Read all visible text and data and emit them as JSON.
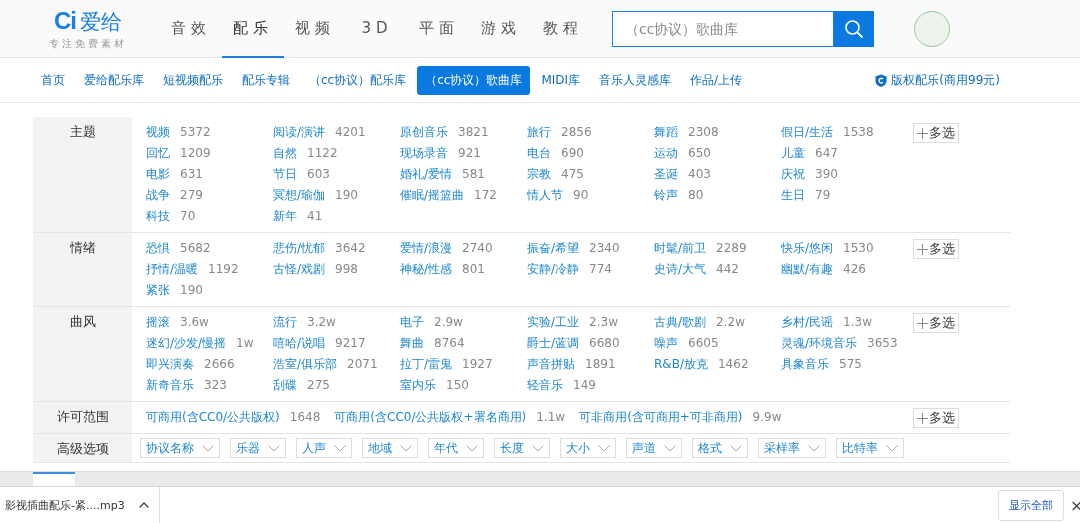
{
  "header": {
    "logo_mark": "Ci",
    "logo_text": "爱给",
    "tagline": "专注免费素材",
    "nav": [
      {
        "label": "音效",
        "selected": false
      },
      {
        "label": "配乐",
        "selected": true
      },
      {
        "label": "视频",
        "selected": false
      },
      {
        "label": "3D",
        "selected": false
      },
      {
        "label": "平面",
        "selected": false
      },
      {
        "label": "游戏",
        "selected": false
      },
      {
        "label": "教程",
        "selected": false
      }
    ],
    "search": {
      "placeholder": "（cc协议）歌曲库"
    }
  },
  "subnav": {
    "items": [
      {
        "label": "首页",
        "selected": false
      },
      {
        "label": "爱给配乐库",
        "selected": false
      },
      {
        "label": "短视频配乐",
        "selected": false
      },
      {
        "label": "配乐专辑",
        "selected": false
      },
      {
        "label": "（cc协议）配乐库",
        "selected": false
      },
      {
        "label": "（cc协议）歌曲库",
        "selected": true
      },
      {
        "label": "MIDI库",
        "selected": false
      },
      {
        "label": "音乐人灵感库",
        "selected": false
      },
      {
        "label": "作品/上传",
        "selected": false
      }
    ],
    "copyright_link": "版权配乐(商用99元)"
  },
  "filters": [
    {
      "kind": "grid",
      "label": "主题",
      "multi_select": "多选",
      "items": [
        {
          "name": "视频",
          "count": "5372"
        },
        {
          "name": "阅读/演讲",
          "count": "4201"
        },
        {
          "name": "原创音乐",
          "count": "3821"
        },
        {
          "name": "旅行",
          "count": "2856"
        },
        {
          "name": "舞蹈",
          "count": "2308"
        },
        {
          "name": "假日/生活",
          "count": "1538"
        },
        {
          "name": "回忆",
          "count": "1209"
        },
        {
          "name": "自然",
          "count": "1122"
        },
        {
          "name": "现场录音",
          "count": "921"
        },
        {
          "name": "电台",
          "count": "690"
        },
        {
          "name": "运动",
          "count": "650"
        },
        {
          "name": "儿童",
          "count": "647"
        },
        {
          "name": "电影",
          "count": "631"
        },
        {
          "name": "节日",
          "count": "603"
        },
        {
          "name": "婚礼/爱情",
          "count": "581"
        },
        {
          "name": "宗教",
          "count": "475"
        },
        {
          "name": "圣诞",
          "count": "403"
        },
        {
          "name": "庆祝",
          "count": "390"
        },
        {
          "name": "战争",
          "count": "279"
        },
        {
          "name": "冥想/瑜伽",
          "count": "190"
        },
        {
          "name": "催眠/摇篮曲",
          "count": "172"
        },
        {
          "name": "情人节",
          "count": "90"
        },
        {
          "name": "铃声",
          "count": "80"
        },
        {
          "name": "生日",
          "count": "79"
        },
        {
          "name": "科技",
          "count": "70"
        },
        {
          "name": "新年",
          "count": "41"
        }
      ]
    },
    {
      "kind": "grid",
      "label": "情绪",
      "multi_select": "多选",
      "items": [
        {
          "name": "恐惧",
          "count": "5682"
        },
        {
          "name": "悲伤/忧郁",
          "count": "3642"
        },
        {
          "name": "爱情/浪漫",
          "count": "2740"
        },
        {
          "name": "振奋/希望",
          "count": "2340"
        },
        {
          "name": "时髦/前卫",
          "count": "2289"
        },
        {
          "name": "快乐/悠闲",
          "count": "1530"
        },
        {
          "name": "抒情/温暖",
          "count": "1192"
        },
        {
          "name": "古怪/戏剧",
          "count": "998"
        },
        {
          "name": "神秘/性感",
          "count": "801"
        },
        {
          "name": "安静/冷静",
          "count": "774"
        },
        {
          "name": "史诗/大气",
          "count": "442"
        },
        {
          "name": "幽默/有趣",
          "count": "426"
        },
        {
          "name": "紧张",
          "count": "190"
        }
      ]
    },
    {
      "kind": "grid",
      "label": "曲风",
      "multi_select": "多选",
      "items": [
        {
          "name": "摇滚",
          "count": "3.6w"
        },
        {
          "name": "流行",
          "count": "3.2w"
        },
        {
          "name": "电子",
          "count": "2.9w"
        },
        {
          "name": "实验/工业",
          "count": "2.3w"
        },
        {
          "name": "古典/歌剧",
          "count": "2.2w"
        },
        {
          "name": "乡村/民谣",
          "count": "1.3w"
        },
        {
          "name": "迷幻/沙发/慢摇",
          "count": "1w"
        },
        {
          "name": "嘻哈/说唱",
          "count": "9217"
        },
        {
          "name": "舞曲",
          "count": "8764"
        },
        {
          "name": "爵士/蓝调",
          "count": "6680"
        },
        {
          "name": "噪声",
          "count": "6605"
        },
        {
          "name": "灵魂/环境音乐",
          "count": "3653"
        },
        {
          "name": "即兴演奏",
          "count": "2666"
        },
        {
          "name": "浩室/俱乐部",
          "count": "2071"
        },
        {
          "name": "拉丁/雷鬼",
          "count": "1927"
        },
        {
          "name": "声音拼贴",
          "count": "1891"
        },
        {
          "name": "R&B/放克",
          "count": "1462"
        },
        {
          "name": "具象音乐",
          "count": "575"
        },
        {
          "name": "新奇音乐",
          "count": "323"
        },
        {
          "name": "刮碟",
          "count": "275"
        },
        {
          "name": "室内乐",
          "count": "150"
        },
        {
          "name": "轻音乐",
          "count": "149"
        }
      ]
    },
    {
      "kind": "inline",
      "label": "许可范围",
      "multi_select": "多选",
      "items": [
        {
          "name": "可商用(含CC0/公共版权)",
          "count": "1648"
        },
        {
          "name": "可商用(含CC0/公共版权+署名商用)",
          "count": "1.1w"
        },
        {
          "name": "可非商用(含可商用+可非商用)",
          "count": "9.9w"
        }
      ]
    },
    {
      "kind": "dropdowns",
      "label": "高级选项",
      "items": [
        {
          "name": "协议名称"
        },
        {
          "name": "乐器"
        },
        {
          "name": "人声"
        },
        {
          "name": "地域"
        },
        {
          "name": "年代"
        },
        {
          "name": "长度"
        },
        {
          "name": "大小"
        },
        {
          "name": "声道"
        },
        {
          "name": "格式"
        },
        {
          "name": "采样率"
        },
        {
          "name": "比特率"
        }
      ]
    }
  ],
  "download_bar": {
    "file": "影视插曲配乐-紧....mp3",
    "show_all": "显示全部",
    "close": "×"
  }
}
